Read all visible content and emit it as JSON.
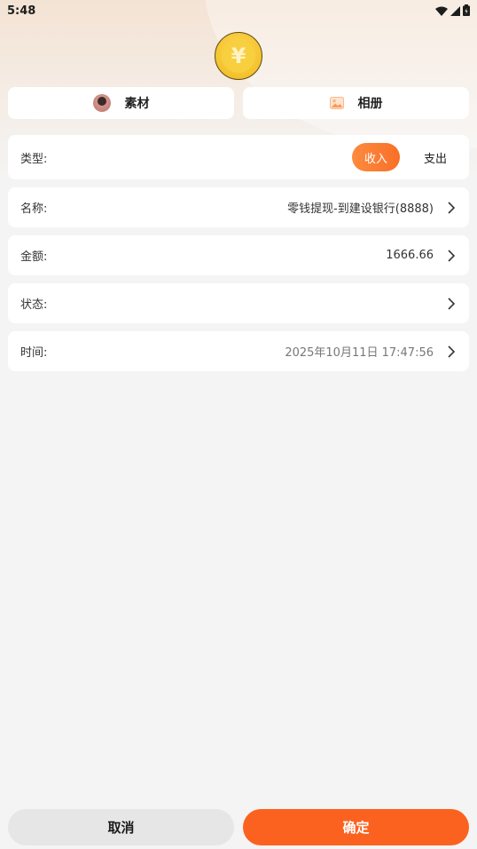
{
  "status_bar": {
    "time": "5:48",
    "icons": [
      "wifi-icon",
      "cellular-signal-icon",
      "battery-icon"
    ]
  },
  "header": {
    "coin_symbol": "¥",
    "coin_icon": "yuan-coin-icon"
  },
  "sources": {
    "material_label": "素材",
    "material_icon": "avatar-icon",
    "album_label": "相册",
    "album_icon": "image-icon"
  },
  "form": {
    "type": {
      "label": "类型:",
      "options": [
        "收入",
        "支出"
      ],
      "selected": "收入"
    },
    "name": {
      "label": "名称:",
      "value": "零钱提现-到建设银行(8888)"
    },
    "amount": {
      "label": "金额:",
      "value": "1666.66"
    },
    "status": {
      "label": "状态:",
      "value": ""
    },
    "time": {
      "label": "时间:",
      "value": "2025年10月11日 17:47:56"
    }
  },
  "actions": {
    "cancel_label": "取消",
    "confirm_label": "确定"
  },
  "colors": {
    "accent": "#fc621f",
    "toggle_on": "#f96f28",
    "background": "#f4f4f4",
    "card": "#ffffff"
  }
}
